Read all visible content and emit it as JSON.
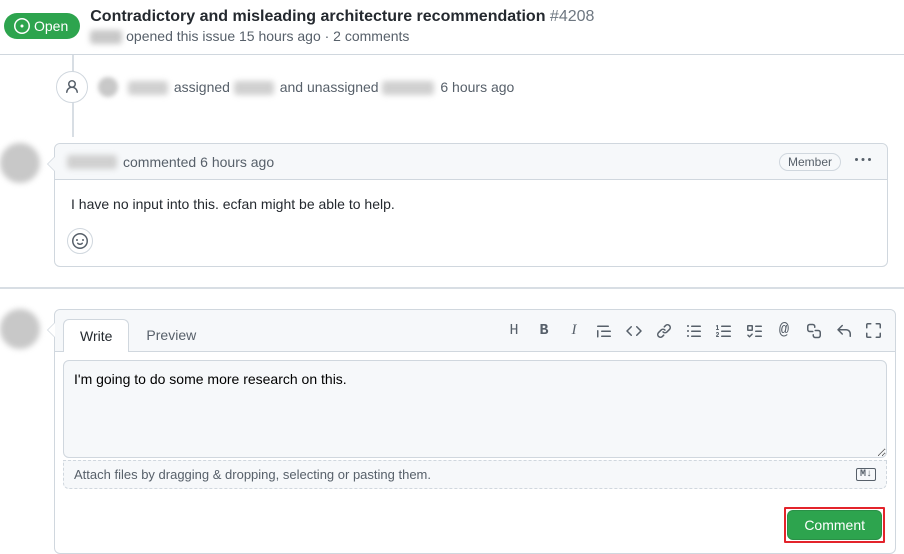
{
  "header": {
    "status": "Open",
    "title": "Contradictory and misleading architecture recommendation",
    "number": "#4208",
    "sub_action": "opened this issue 15 hours ago · 2 comments"
  },
  "event": {
    "action1": "assigned",
    "action2": "and unassigned",
    "time": "6 hours ago"
  },
  "comment": {
    "verb": "commented",
    "time": "6 hours ago",
    "badge": "Member",
    "body": "I have no input into this. ecfan might be able to help."
  },
  "editor": {
    "tab_write": "Write",
    "tab_preview": "Preview",
    "text": "I'm going to do some more research on this.",
    "attach_hint": "Attach files by dragging & dropping, selecting or pasting them.",
    "md_badge": "M↓",
    "submit": "Comment"
  }
}
